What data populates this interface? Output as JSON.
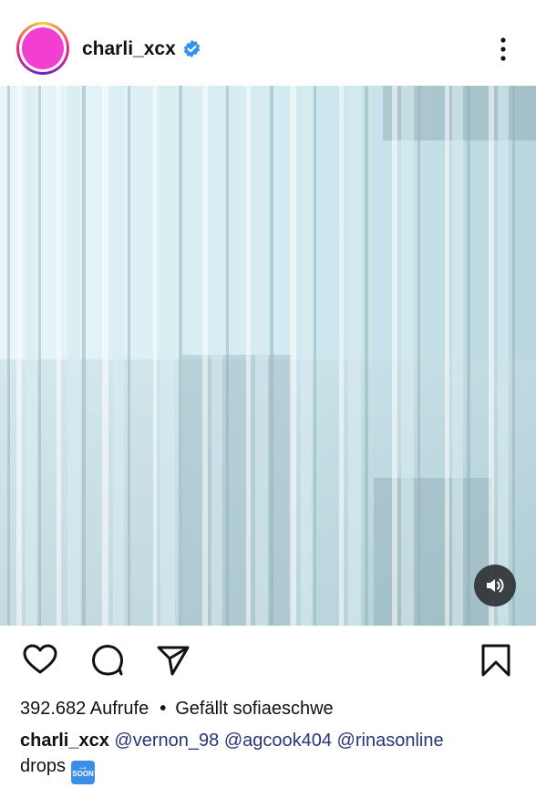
{
  "post": {
    "username": "charli_xcx",
    "verified_icon": "verified-badge-icon",
    "more_icon": "more-vertical-icon",
    "avatar_color": "#f23fd2",
    "media": {
      "type": "video",
      "sound_icon": "speaker-icon"
    },
    "actions": {
      "like_icon": "heart-icon",
      "comment_icon": "comment-icon",
      "share_icon": "send-icon",
      "save_icon": "bookmark-icon"
    },
    "stats": {
      "views": "392.682 Aufrufe",
      "separator": "•",
      "liked_by": "Gefällt sofiaeschwe"
    },
    "caption": {
      "user": "charli_xcx",
      "mention_1": "@vernon_98",
      "mention_2": "@agcook404",
      "mention_3": "@rinasonline",
      "text": "drops",
      "emoji_label": "SOON"
    }
  }
}
